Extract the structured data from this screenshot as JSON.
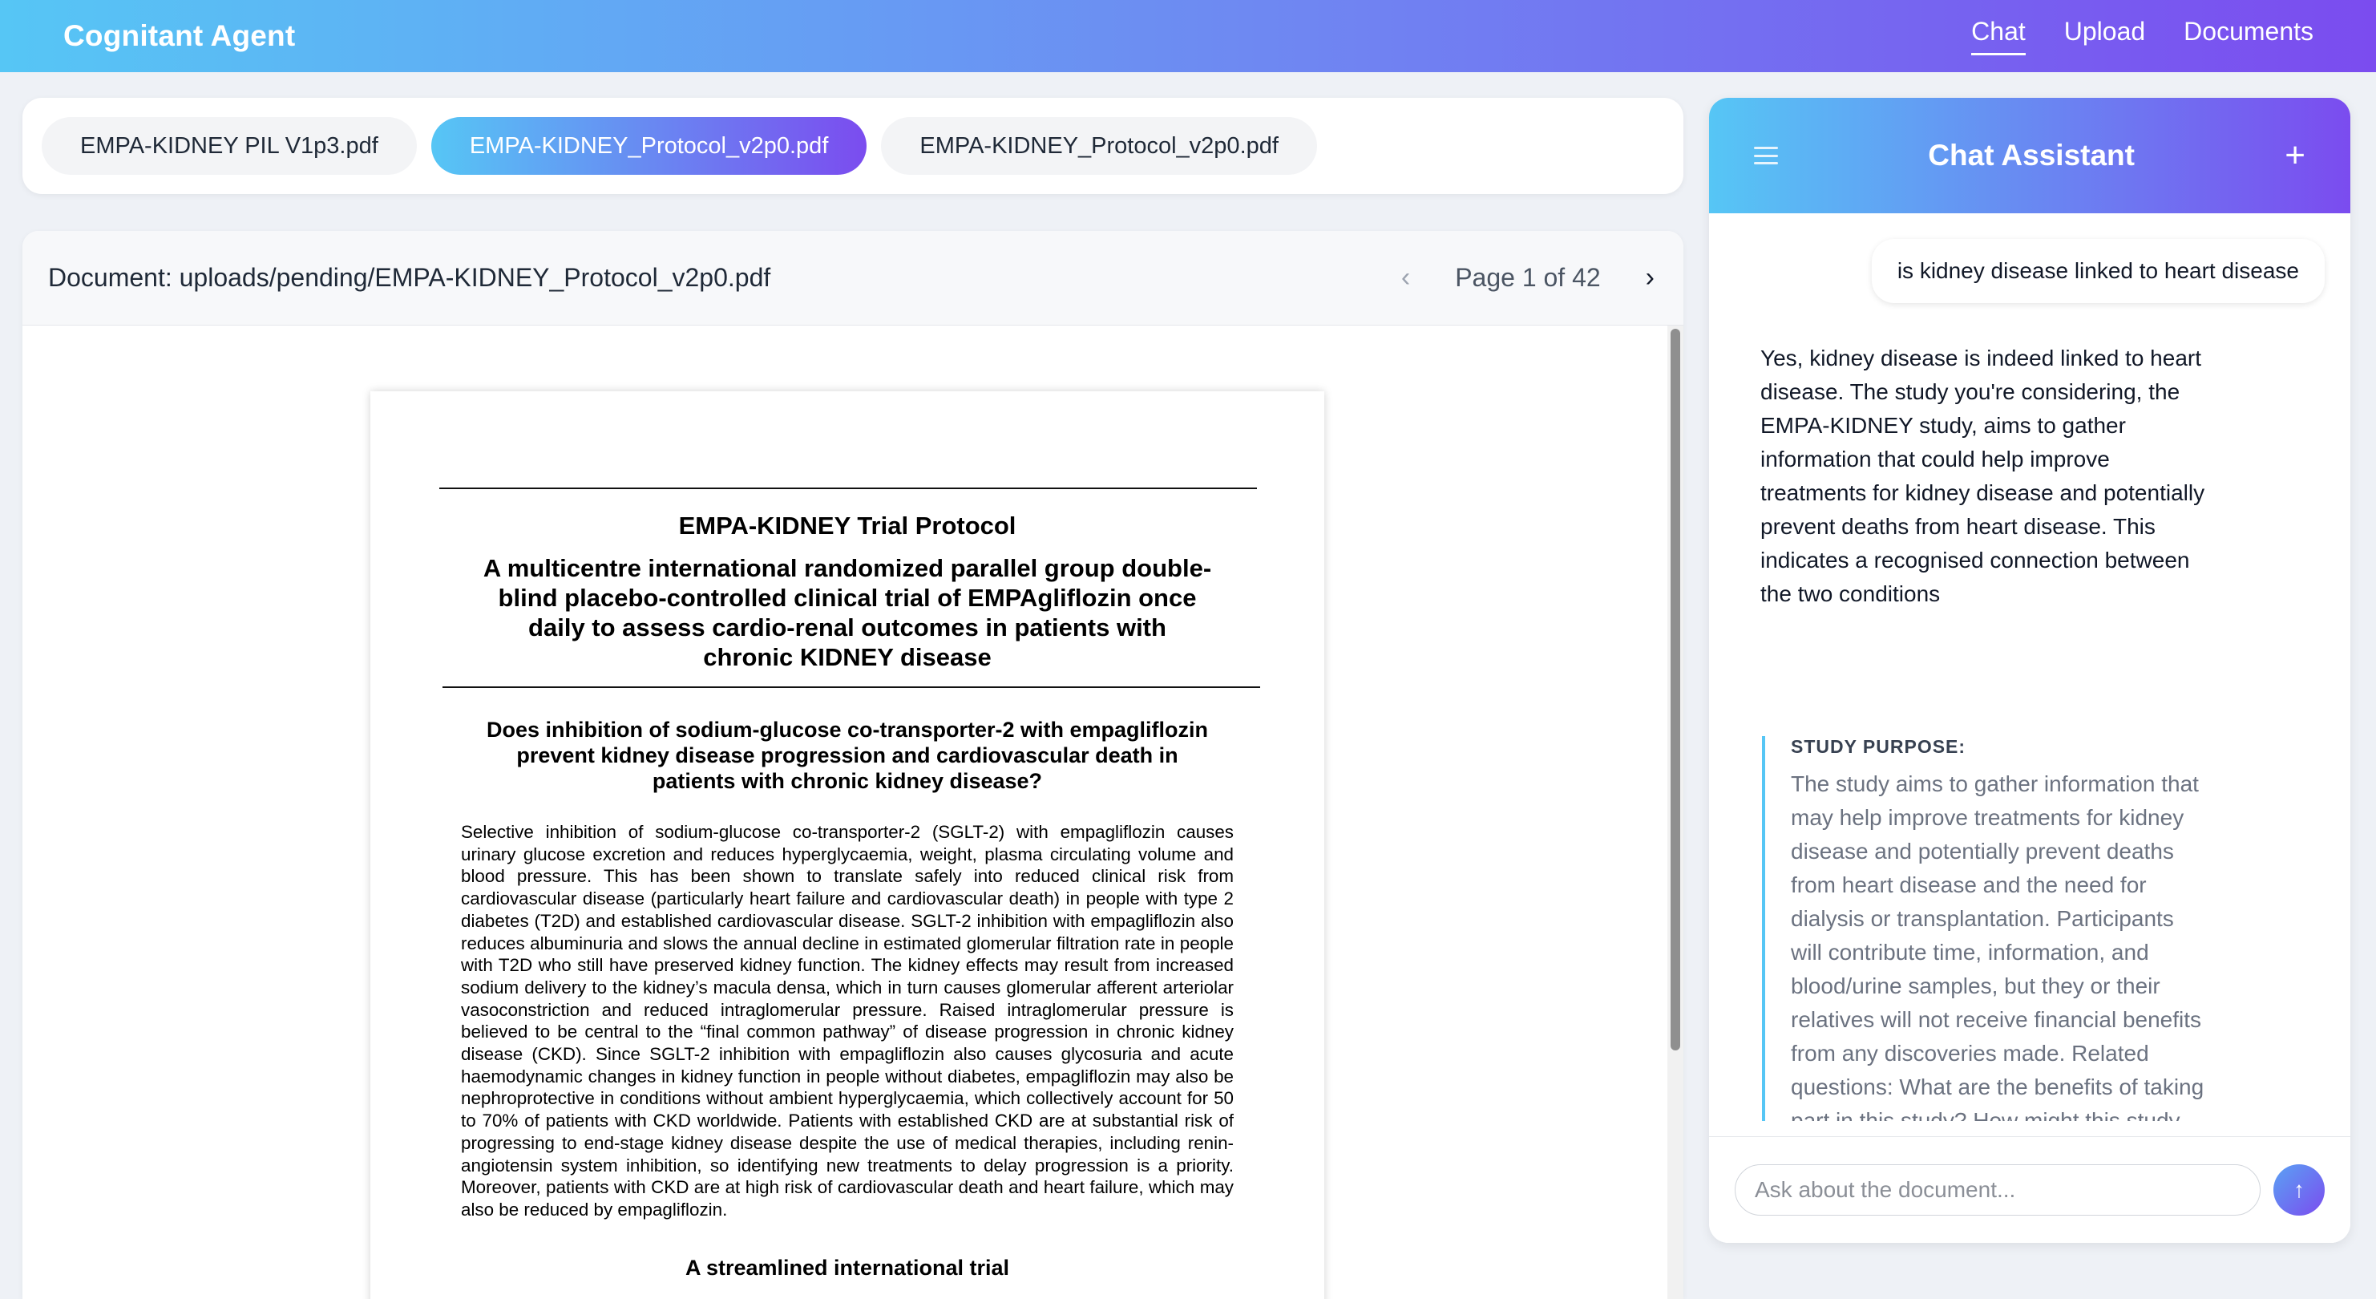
{
  "app": {
    "brand": "Cognitant Agent",
    "nav": [
      "Chat",
      "Upload",
      "Documents"
    ],
    "active_nav": "Chat"
  },
  "tabs": [
    {
      "label": "EMPA-KIDNEY PIL V1p3.pdf",
      "active": false
    },
    {
      "label": "EMPA-KIDNEY_Protocol_v2p0.pdf",
      "active": true
    },
    {
      "label": "EMPA-KIDNEY_Protocol_v2p0.pdf",
      "active": false
    }
  ],
  "viewer": {
    "path": "Document: uploads/pending/EMPA-KIDNEY_Protocol_v2p0.pdf",
    "page_label": "Page 1 of 42",
    "prev": "‹",
    "next": "›"
  },
  "document": {
    "title": "EMPA-KIDNEY Trial Protocol",
    "subtitle_lines": [
      "A multicentre international randomized parallel group double-",
      "blind placebo-controlled clinical trial of EMPAgliflozin once",
      "daily to assess cardio-renal outcomes in patients with",
      "chronic KIDNEY disease"
    ],
    "question_lines": [
      "Does inhibition of sodium-glucose co-transporter-2 with empagliflozin",
      "prevent kidney disease progression and cardiovascular death in",
      "patients with chronic kidney disease?"
    ],
    "body": "Selective inhibition of sodium-glucose co-transporter-2 (SGLT-2) with empagliflozin causes urinary glucose excretion and reduces hyperglycaemia, weight, plasma circulating volume and blood pressure. This has been shown to translate safely into reduced clinical risk from cardiovascular disease (particularly heart failure and cardiovascular death) in people with type 2 diabetes (T2D) and established cardiovascular disease. SGLT-2 inhibition with empagliflozin also reduces albuminuria and slows the annual decline in estimated glomerular filtration rate in people with T2D who still have preserved kidney function. The kidney effects may result from increased sodium delivery to the kidney’s macula densa, which in turn causes glomerular afferent arteriolar vasoconstriction and reduced intraglomerular pressure. Raised intraglomerular pressure is believed to be central to the “final common pathway” of disease progression in chronic kidney disease (CKD). Since SGLT-2 inhibition with empagliflozin also causes glycosuria and acute haemodynamic changes in kidney function in people without diabetes, empagliflozin may also be nephroprotective in conditions without ambient hyperglycaemia, which collectively account for 50 to 70% of patients with CKD worldwide. Patients with established CKD are at substantial risk of progressing to end-stage kidney disease despite the use of medical therapies, including renin-angiotensin system inhibition, so identifying new treatments to delay progression is a priority. Moreover, patients with CKD are at high risk of cardiovascular death and heart failure, which may also be reduced by empagliflozin.",
    "section_heading": "A streamlined international trial"
  },
  "chat": {
    "title": "Chat Assistant",
    "user_message": "is kidney disease linked to heart disease",
    "bot_message": "Yes, kidney disease is indeed linked to heart disease. The study you're considering, the EMPA-KIDNEY study, aims to gather information that could help improve treatments for kidney disease and potentially prevent deaths from heart disease. This indicates a recognised connection between the two conditions",
    "quote_heading": "STUDY PURPOSE:",
    "quote_body": "The study aims to gather information that may help improve treatments for kidney disease and potentially prevent deaths from heart disease and the need for dialysis or transplantation. Participants will contribute time, information, and blood/urine samples, but they or their relatives will not receive financial benefits from any discoveries made. Related questions: What are the benefits of taking part in this study? How might this study help improve treatment for kidney disease? Will participants receive any financial",
    "input_placeholder": "Ask about the document...",
    "send_icon": "↑"
  },
  "colors": {
    "gradient_start": "#56c6f5",
    "gradient_end": "#7b4cef",
    "quote_border": "#56c6f5"
  }
}
